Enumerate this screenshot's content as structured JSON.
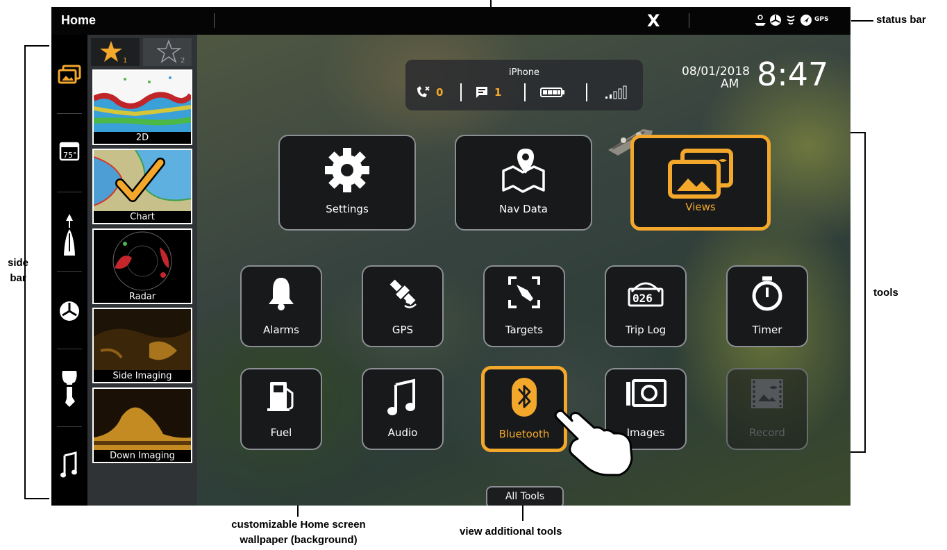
{
  "status_bar": {
    "title": "Home",
    "x_brand": "X",
    "gps_label": "GPS"
  },
  "sidebar": {
    "items": [
      {
        "icon": "views-icon"
      },
      {
        "icon": "nav-data-icon"
      },
      {
        "icon": "navigation-icon"
      },
      {
        "icon": "radar-icon"
      },
      {
        "icon": "engine-icon"
      },
      {
        "icon": "music-icon"
      }
    ],
    "accent": "#f3a82c"
  },
  "favorites": {
    "tabs": [
      {
        "label": "1",
        "active": true
      },
      {
        "label": "2",
        "active": false
      }
    ],
    "views": [
      {
        "label": "2D"
      },
      {
        "label": "Chart"
      },
      {
        "label": "Radar"
      },
      {
        "label": "Side Imaging"
      },
      {
        "label": "Down Imaging"
      }
    ]
  },
  "phone": {
    "name": "iPhone",
    "missed_calls": "0",
    "messages": "1"
  },
  "clock": {
    "date": "08/01/2018",
    "ampm": "AM",
    "time": "8:47"
  },
  "tools": {
    "main": [
      {
        "label": "Settings",
        "selected": false
      },
      {
        "label": "Nav Data",
        "selected": false
      },
      {
        "label": "Views",
        "selected": true
      }
    ],
    "row2": [
      {
        "label": "Alarms"
      },
      {
        "label": "GPS"
      },
      {
        "label": "Targets"
      },
      {
        "label": "Trip Log"
      },
      {
        "label": "Timer"
      }
    ],
    "row3": [
      {
        "label": "Fuel"
      },
      {
        "label": "Audio"
      },
      {
        "label": "Bluetooth",
        "selected": true
      },
      {
        "label": "Images"
      },
      {
        "label": "Record",
        "disabled": true
      }
    ],
    "all_tools": "All Tools"
  },
  "annotations": {
    "status_bar": "status bar",
    "side_bar_1": "side",
    "side_bar_2": "bar",
    "tools": "tools",
    "wallpaper_1": "customizable Home screen",
    "wallpaper_2": "wallpaper (background)",
    "view_additional": "view additional tools"
  },
  "colors": {
    "accent": "#f3a82c",
    "background": "#000000",
    "tile": "#17191b"
  }
}
